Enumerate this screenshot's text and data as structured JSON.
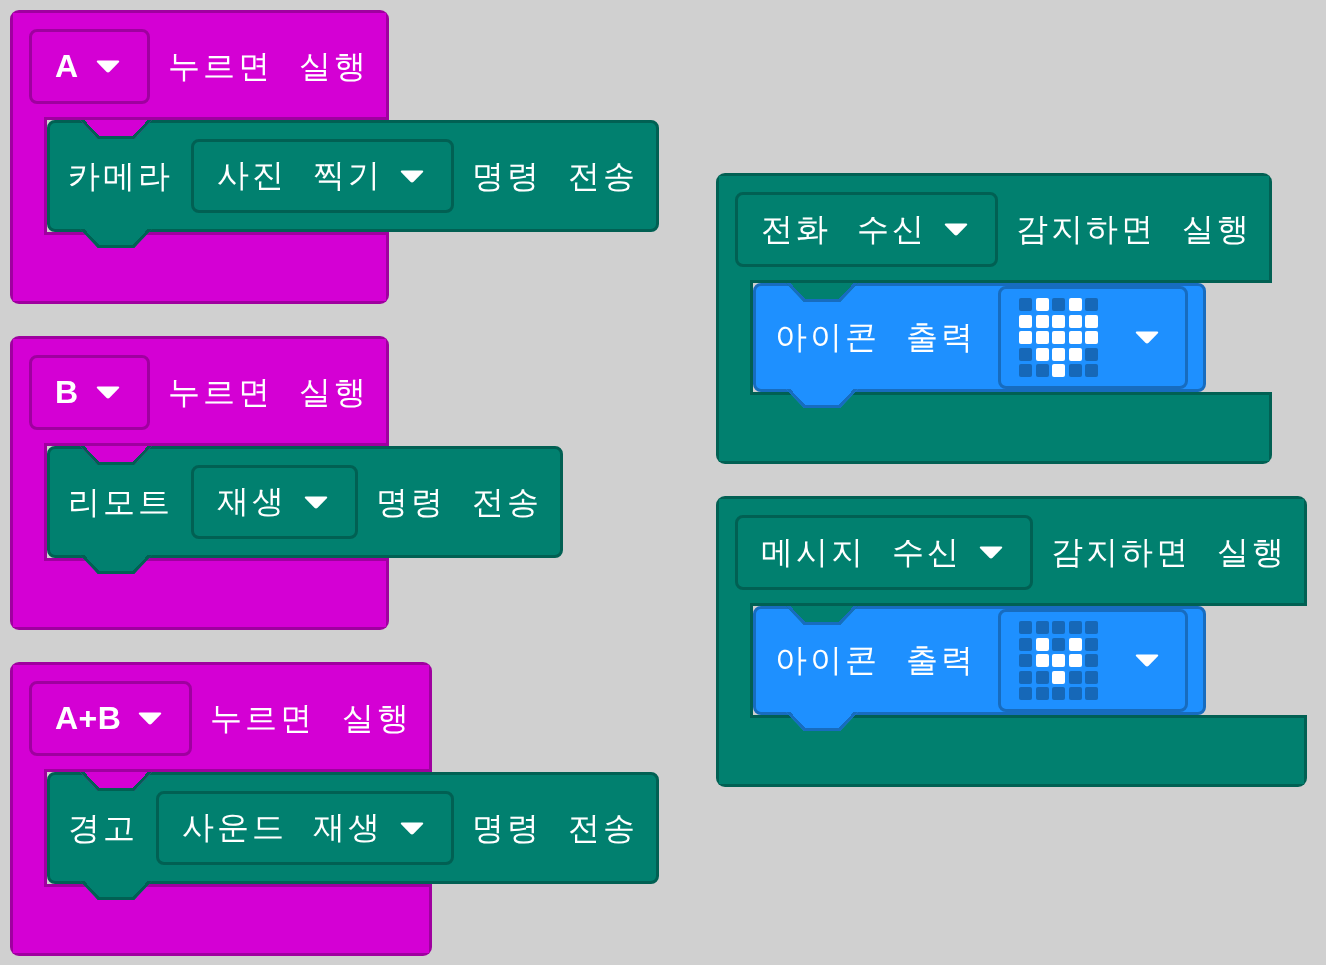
{
  "columns": [
    {
      "blocks": [
        {
          "kind": "button",
          "color": "#d400d4",
          "trigger": "A",
          "label": "누르면 실행",
          "body": [
            {
              "kind": "command",
              "color": "#01806f",
              "label": "카메라",
              "option": "사진 찍기",
              "suffix": "명령 전송"
            }
          ]
        },
        {
          "kind": "button",
          "color": "#d400d4",
          "trigger": "B",
          "label": "누르면 실행",
          "body": [
            {
              "kind": "command",
              "color": "#01806f",
              "label": "리모트",
              "option": "재생",
              "suffix": "명령 전송"
            }
          ]
        },
        {
          "kind": "button",
          "color": "#d400d4",
          "trigger": "A+B",
          "label": "누르면 실행",
          "body": [
            {
              "kind": "command",
              "color": "#01806f",
              "label": "경고",
              "option": "사운드 재생",
              "suffix": "명령 전송"
            }
          ]
        }
      ]
    },
    {
      "blocks": [
        {
          "kind": "event",
          "color": "#01806f",
          "trigger": "전화 수신",
          "label": "감지하면 실행",
          "body": [
            {
              "kind": "icon",
              "color": "#1e90ff",
              "label": "아이콘 출력",
              "leds": [
                [
                  false,
                  true,
                  false,
                  true,
                  false
                ],
                [
                  true,
                  true,
                  true,
                  true,
                  true
                ],
                [
                  true,
                  true,
                  true,
                  true,
                  true
                ],
                [
                  false,
                  true,
                  true,
                  true,
                  false
                ],
                [
                  false,
                  false,
                  true,
                  false,
                  false
                ]
              ]
            }
          ]
        },
        {
          "kind": "event",
          "color": "#01806f",
          "trigger": "메시지 수신",
          "label": "감지하면 실행",
          "body": [
            {
              "kind": "icon",
              "color": "#1e90ff",
              "label": "아이콘 출력",
              "leds": [
                [
                  false,
                  false,
                  false,
                  false,
                  false
                ],
                [
                  false,
                  true,
                  false,
                  true,
                  false
                ],
                [
                  false,
                  true,
                  true,
                  true,
                  false
                ],
                [
                  false,
                  false,
                  true,
                  false,
                  false
                ],
                [
                  false,
                  false,
                  false,
                  false,
                  false
                ]
              ]
            }
          ]
        }
      ]
    }
  ]
}
